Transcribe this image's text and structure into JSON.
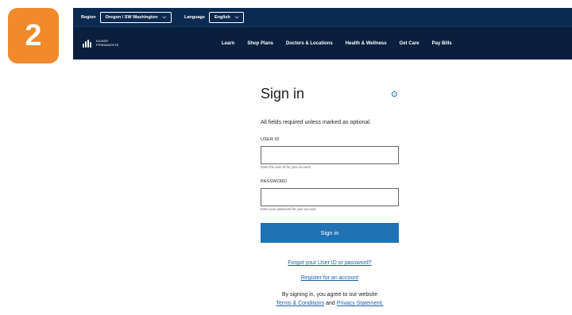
{
  "step": {
    "number": "2",
    "color": "#f08a2a"
  },
  "topbar": {
    "region_label": "Region",
    "region_value": "Oregon / SW Washington",
    "language_label": "Language",
    "language_value": "English",
    "chevron_icon": "chevron-down-icon"
  },
  "header": {
    "logo_line1": "KAISER",
    "logo_line2": "PERMANENTE.",
    "nav": [
      "Learn",
      "Shop Plans",
      "Doctors & Locations",
      "Health & Wellness",
      "Get Care",
      "Pay Bills"
    ]
  },
  "signin": {
    "title": "Sign in",
    "help_icon": "help-circle-icon",
    "note": "All fields required unless marked as optional.",
    "user_id_label": "USER ID",
    "user_id_value": "",
    "user_id_hint": "Enter the user ID for your account",
    "password_label": "PASSWORD",
    "password_value": "",
    "password_hint": "Enter your password for your account",
    "button": "Sign in",
    "forgot_link": "Forgot your User ID or password?",
    "register_link": "Register for an account",
    "legal_text": "By signing in, you agree to our website",
    "terms_link": "Terms & Conditions",
    "and_text": "and",
    "privacy_link": "Privacy Statement."
  },
  "colors": {
    "topbar": "#0b2a52",
    "navbar": "#0a1f3d",
    "primary_button": "#1f72b6",
    "link": "#1f5fa5"
  }
}
